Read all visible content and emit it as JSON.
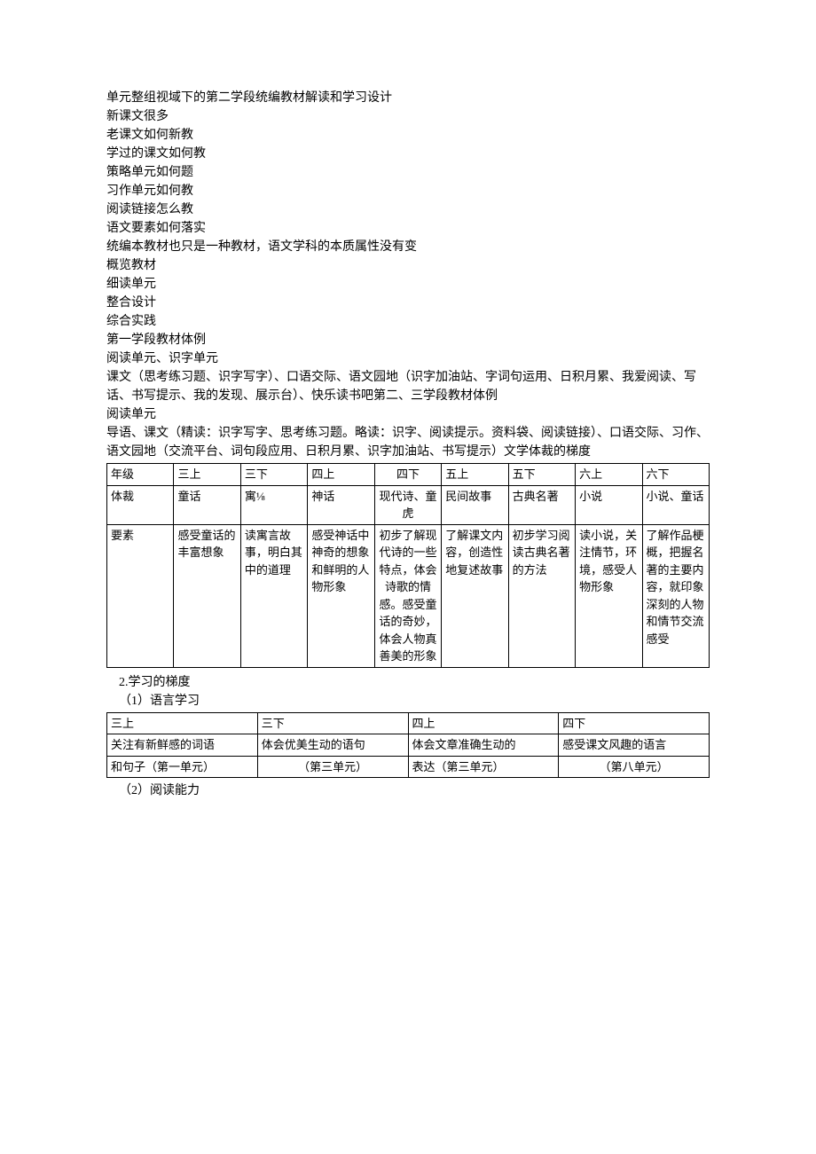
{
  "lines": [
    "单元整组视域下的第二学段统编教材解读和学习设计",
    "新课文很多",
    "老课文如何新教",
    "学过的课文如何教",
    "策略单元如何题",
    "习作单元如何教",
    "阅读链接怎么教",
    "语文要素如何落实",
    "统编本教材也只是一种教材，语文学科的本质属性没有变",
    "概览教材",
    "细读单元",
    "整合设计",
    "综合实践",
    "第一学段教材体例",
    "阅读单元、识字单元",
    "课文（思考练习题、识字写字）、口语交际、语文园地（识字加油站、字词句运用、日积月累、我爱阅读、写话、书写提示、我的发现、展示台）、快乐读书吧第二、三学段教材体例",
    "阅读单元",
    "导语、课文（精读：识字写字、思考练习题。略读：识字、阅读提示。资料袋、阅读链接）、口语交际、习作、语文园地（交流平台、词句段应用、日积月累、识字加油站、书写提示）文学体裁的梯度"
  ],
  "table1": {
    "rows": [
      [
        "年级",
        "三上",
        "三下",
        "四上",
        "四下",
        "五上",
        "五下",
        "六上",
        "六下"
      ],
      [
        "体裁",
        "童话",
        "寓⅛",
        "神话",
        "现代诗、童虎",
        "民间故事",
        "古典名著",
        "小说",
        "小说、童话"
      ],
      [
        "要素",
        "感受童话的丰富想象",
        "读寓言故事，明白其中的道理",
        "感受神话中神奇的想象和鲜明的人物形象",
        "初步了解现代诗的一些特点，体会诗歌的情感。感受童话的奇妙，体会人物真善美的形象",
        "了解课文内容，创造性地复述故事",
        "初步学习阅读古典名著的方法",
        "读小说，关注情节，环境，感受人物形象",
        "了解作品梗概，把握名著的主要内容，就印象深刻的人物和情节交流感受"
      ]
    ]
  },
  "section2": "2.学习的梯度",
  "section2_1": "（1）语言学习",
  "table2": {
    "rows": [
      [
        "三上",
        "三下",
        "四上",
        "四下"
      ],
      [
        "关注有新鲜感的词语",
        "体会优美生动的语句",
        "体会文章准确生动的",
        "感受课文风趣的语言"
      ],
      [
        "和句子（第一单元）",
        "（第三单元）",
        "表达（第三单元）",
        "（第八单元）"
      ]
    ]
  },
  "section2_2": "（2）阅读能力"
}
